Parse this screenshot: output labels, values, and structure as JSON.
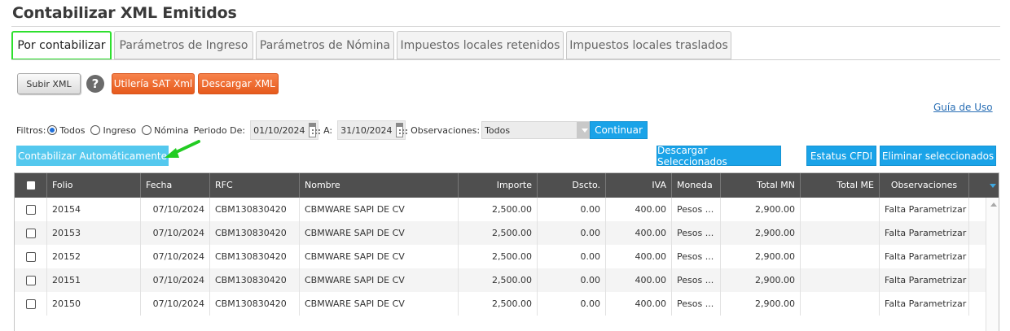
{
  "page": {
    "title": "Contabilizar XML Emitidos"
  },
  "tabs": [
    {
      "label": "Por contabilizar",
      "active": true
    },
    {
      "label": "Parámetros de Ingreso"
    },
    {
      "label": "Parámetros de Nómina"
    },
    {
      "label": "Impuestos locales retenidos"
    },
    {
      "label": "Impuestos locales traslados"
    }
  ],
  "toolbar": {
    "upload_label": "Subir XML",
    "help_glyph": "?",
    "sat_label": "Utilería SAT Xml",
    "download_label": "Descargar XML",
    "guide_link": "Guía de Uso"
  },
  "filters": {
    "label": "Filtros:",
    "options": [
      "Todos",
      "Ingreso",
      "Nómina"
    ],
    "selected": "Todos",
    "period_label": "Periodo De:",
    "date_from": "01/10/2024",
    "to_label": "A:",
    "date_to": "31/10/2024",
    "observations_label": "Observaciones:",
    "observations_value": "Todos",
    "continue_label": "Continuar"
  },
  "actions": {
    "auto_label": "Contabilizar Automáticamente",
    "download_selected": "Descargar Seleccionados",
    "status_cfdi": "Estatus CFDI",
    "delete_selected": "Eliminar seleccionados"
  },
  "colors": {
    "active_tab_border": "#2ee02e",
    "orange": "#e65a1c",
    "blue": "#1aa3e8",
    "light_blue": "#54c8ee",
    "header_bg": "#4f4f4f",
    "arrow": "#22cc22"
  },
  "icons": [
    "help-icon",
    "calendar-icon",
    "chevron-down-icon",
    "arrow-icon",
    "sort-icon"
  ],
  "table": {
    "columns": [
      "Folio",
      "Fecha",
      "RFC",
      "Nombre",
      "Importe",
      "Dscto.",
      "IVA",
      "Moneda",
      "Total MN",
      "Total ME",
      "Observaciones"
    ],
    "rows": [
      {
        "folio": "20154",
        "fecha": "07/10/2024",
        "rfc": "CBM130830420",
        "nombre": "CBMWARE SAPI DE CV",
        "importe": "2,500.00",
        "dscto": "0.00",
        "iva": "400.00",
        "moneda": "Pesos ...",
        "total_mn": "2,900.00",
        "total_me": "",
        "observaciones": "Falta Parametrizar"
      },
      {
        "folio": "20153",
        "fecha": "07/10/2024",
        "rfc": "CBM130830420",
        "nombre": "CBMWARE SAPI DE CV",
        "importe": "2,500.00",
        "dscto": "0.00",
        "iva": "400.00",
        "moneda": "Pesos ...",
        "total_mn": "2,900.00",
        "total_me": "",
        "observaciones": "Falta Parametrizar"
      },
      {
        "folio": "20152",
        "fecha": "07/10/2024",
        "rfc": "CBM130830420",
        "nombre": "CBMWARE SAPI DE CV",
        "importe": "2,500.00",
        "dscto": "0.00",
        "iva": "400.00",
        "moneda": "Pesos ...",
        "total_mn": "2,900.00",
        "total_me": "",
        "observaciones": "Falta Parametrizar"
      },
      {
        "folio": "20151",
        "fecha": "07/10/2024",
        "rfc": "CBM130830420",
        "nombre": "CBMWARE SAPI DE CV",
        "importe": "2,500.00",
        "dscto": "0.00",
        "iva": "400.00",
        "moneda": "Pesos ...",
        "total_mn": "2,900.00",
        "total_me": "",
        "observaciones": "Falta Parametrizar"
      },
      {
        "folio": "20150",
        "fecha": "07/10/2024",
        "rfc": "CBM130830420",
        "nombre": "CBMWARE SAPI DE CV",
        "importe": "2,500.00",
        "dscto": "0.00",
        "iva": "400.00",
        "moneda": "Pesos ...",
        "total_mn": "2,900.00",
        "total_me": "",
        "observaciones": "Falta Parametrizar"
      }
    ]
  }
}
